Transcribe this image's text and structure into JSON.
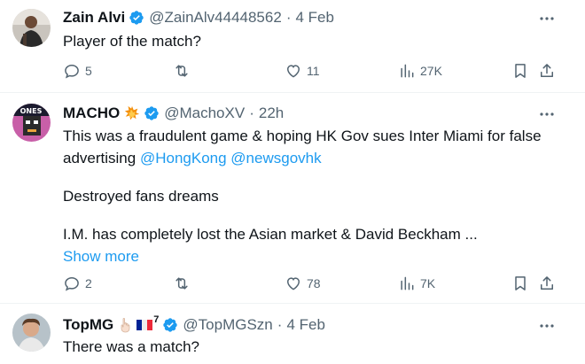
{
  "tweets": [
    {
      "name": "Zain Alvi",
      "handle": "@ZainAlv44448562",
      "time": "4 Feb",
      "text": "Player of the match?",
      "replies": "5",
      "reposts": "",
      "likes": "11",
      "views": "27K"
    },
    {
      "name": "MACHO",
      "handle": "@MachoXV",
      "time": "22h",
      "text_line1": "This was a fraudulent game & hoping HK Gov sues Inter Miami for false",
      "text_line2_prefix": "advertising",
      "mention1": "@HongKong",
      "mention2": "@newsgovhk",
      "text_para2": "Destroyed fans dreams",
      "text_para3": "I.M. has completely lost the Asian market & David Beckham ...",
      "show_more": "Show more",
      "replies": "2",
      "reposts": "",
      "likes": "78",
      "views": "7K"
    },
    {
      "name": "TopMG",
      "handle": "@TopMGSzn",
      "time": "4 Feb",
      "text": "There was a match?",
      "flag_superscript": "7"
    }
  ],
  "colors": {
    "accent": "#1d9bf0",
    "muted": "#536471",
    "text": "#0f1419"
  },
  "icons": [
    "reply-icon",
    "repost-icon",
    "like-icon",
    "views-icon",
    "bookmark-icon",
    "share-icon",
    "verified-badge-icon",
    "more-icon",
    "collision-emoji-icon",
    "hand-emoji-icon",
    "france-flag-icon"
  ]
}
